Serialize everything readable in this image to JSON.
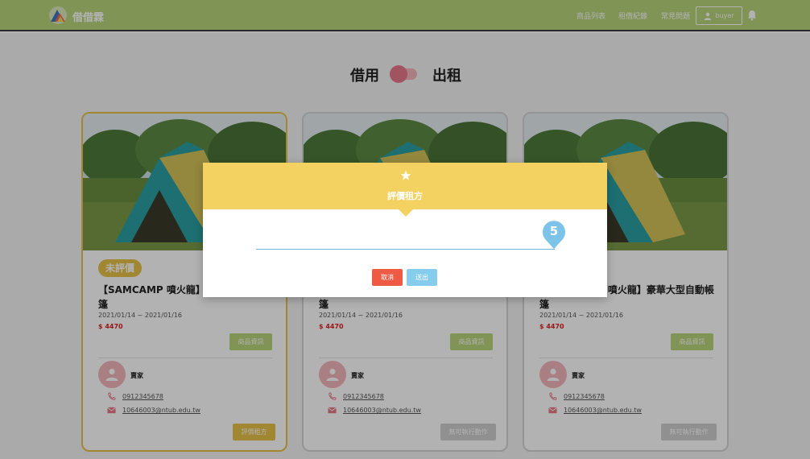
{
  "nav": {
    "brand": "借借霖",
    "links": [
      "商品列表",
      "租借紀錄",
      "常見問題"
    ],
    "user": "buyer"
  },
  "toggle": {
    "left_label": "借用",
    "right_label": "出租"
  },
  "cards": [
    {
      "badge": "未評價",
      "title": "【SAMCAMP 噴火龍】豪華大型自動帳篷",
      "date": "2021/01/14 ~ 2021/01/16",
      "price": "$ 4470",
      "info_button": "商品資訊",
      "seller_label": "賣家",
      "phone": "0912345678",
      "email": "10646003@ntub.edu.tw",
      "action_button": "評價租方"
    },
    {
      "title": "【SAMCAMP 噴火龍】豪華大型自動帳篷",
      "date": "2021/01/14 ~ 2021/01/16",
      "price": "$ 4470",
      "info_button": "商品資訊",
      "seller_label": "賣家",
      "phone": "0912345678",
      "email": "10646003@ntub.edu.tw",
      "action_button": "無可執行動作"
    },
    {
      "title": "【SAMCAMP 噴火龍】豪華大型自動帳篷",
      "date": "2021/01/14 ~ 2021/01/16",
      "price": "$ 4470",
      "info_button": "商品資訊",
      "seller_label": "賣家",
      "phone": "0912345678",
      "email": "10646003@ntub.edu.tw",
      "action_button": "無可執行動作"
    }
  ],
  "modal": {
    "title": "評價租方",
    "rating_value": "5",
    "cancel": "取消",
    "submit": "送出"
  },
  "colors": {
    "navbar": "#b8d47c",
    "accent_yellow": "#e8c24a",
    "modal_header": "#f4d261",
    "cancel": "#ef5a45",
    "submit": "#86ccec",
    "toggle": "#e8788a"
  }
}
